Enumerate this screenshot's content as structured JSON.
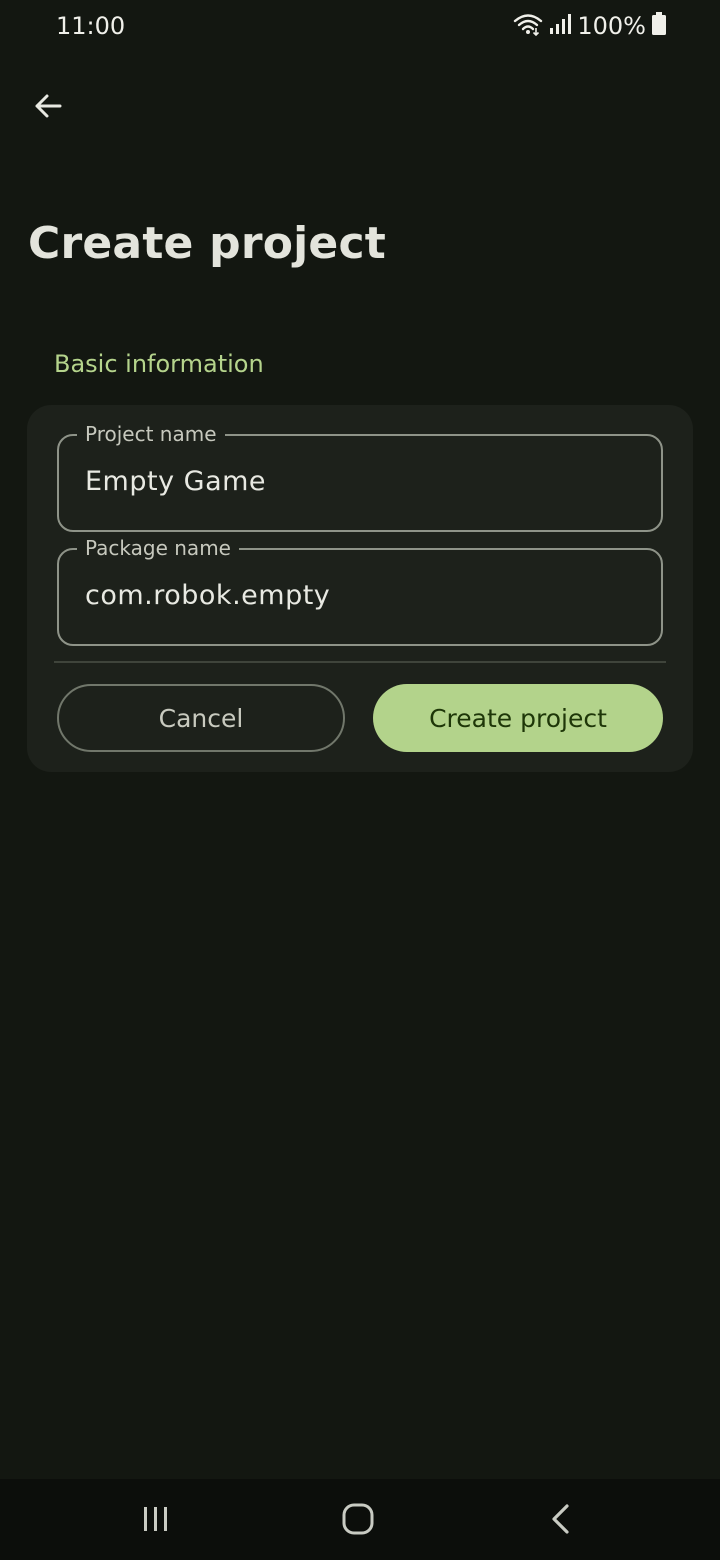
{
  "status_bar": {
    "time": "11:00",
    "battery": "100%",
    "icons": [
      "wifi-icon",
      "signal-icon",
      "battery-icon"
    ]
  },
  "app_bar": {
    "back_icon": "arrow-left-icon"
  },
  "page": {
    "title": "Create project",
    "section_label": "Basic information"
  },
  "form": {
    "project_name": {
      "label": "Project name",
      "value": "Empty Game"
    },
    "package_name": {
      "label": "Package name",
      "value": "com.robok.empty"
    }
  },
  "actions": {
    "cancel_label": "Cancel",
    "create_label": "Create project"
  },
  "nav_bar": {
    "icons": [
      "recents-icon",
      "home-icon",
      "back-icon"
    ]
  },
  "colors": {
    "background": "#131711",
    "card": "#1d211b",
    "accent": "#b3d38b",
    "section_label": "#b5d48c"
  }
}
